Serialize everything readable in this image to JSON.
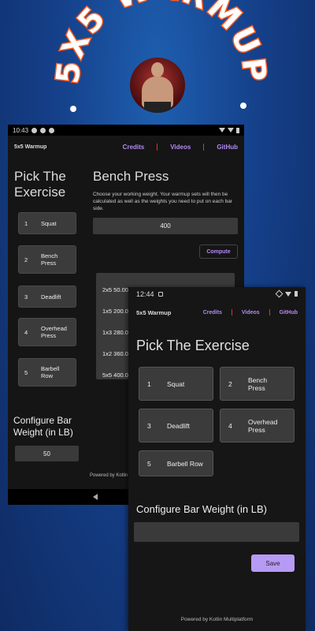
{
  "promo": {
    "title": "5X5 WARMUP",
    "accent_color": "#ff5a1f",
    "background_color": "#15408a"
  },
  "phone1": {
    "status": {
      "time": "10:43"
    },
    "topbar": {
      "app_title": "5x5 Warmup",
      "nav": [
        "Credits",
        "Videos",
        "GitHub"
      ]
    },
    "left": {
      "heading": "Pick The Exercise",
      "exercises": [
        {
          "num": "1",
          "label": "Squat"
        },
        {
          "num": "2",
          "label": "Bench Press"
        },
        {
          "num": "3",
          "label": "Deadlift"
        },
        {
          "num": "4",
          "label": "Overhead Press"
        },
        {
          "num": "5",
          "label": "Barbell Row"
        }
      ],
      "config_label": "Configure Bar Weight (in LB)",
      "bar_weight": "50",
      "powered_by": "Powered by Kotlin"
    },
    "right": {
      "exercise_title": "Bench Press",
      "description": "Choose your working weight. Your warmup sets will then be calculated as well as the weights you need to put on each bar side.",
      "working_weight": "400",
      "compute_label": "Compute",
      "results": [
        "2x5 50.00 lbs",
        "1x5 200.0",
        "1x3 280.0",
        "1x2 360.0",
        "5x5 400.0"
      ]
    }
  },
  "phone2": {
    "status": {
      "time": "12:44"
    },
    "topbar": {
      "app_title": "5x5 Warmup",
      "nav": [
        "Credits",
        "Videos",
        "GitHub"
      ]
    },
    "heading": "Pick The Exercise",
    "exercises": [
      {
        "num": "1",
        "label": "Squat"
      },
      {
        "num": "2",
        "label": "Bench Press"
      },
      {
        "num": "3",
        "label": "Deadlift"
      },
      {
        "num": "4",
        "label": "Overhead Press"
      },
      {
        "num": "5",
        "label": "Barbell Row"
      }
    ],
    "config_label": "Configure Bar Weight (in LB)",
    "bar_weight_value": "",
    "save_label": "Save",
    "powered_by": "Powered by Kotlin Multiplatform"
  }
}
